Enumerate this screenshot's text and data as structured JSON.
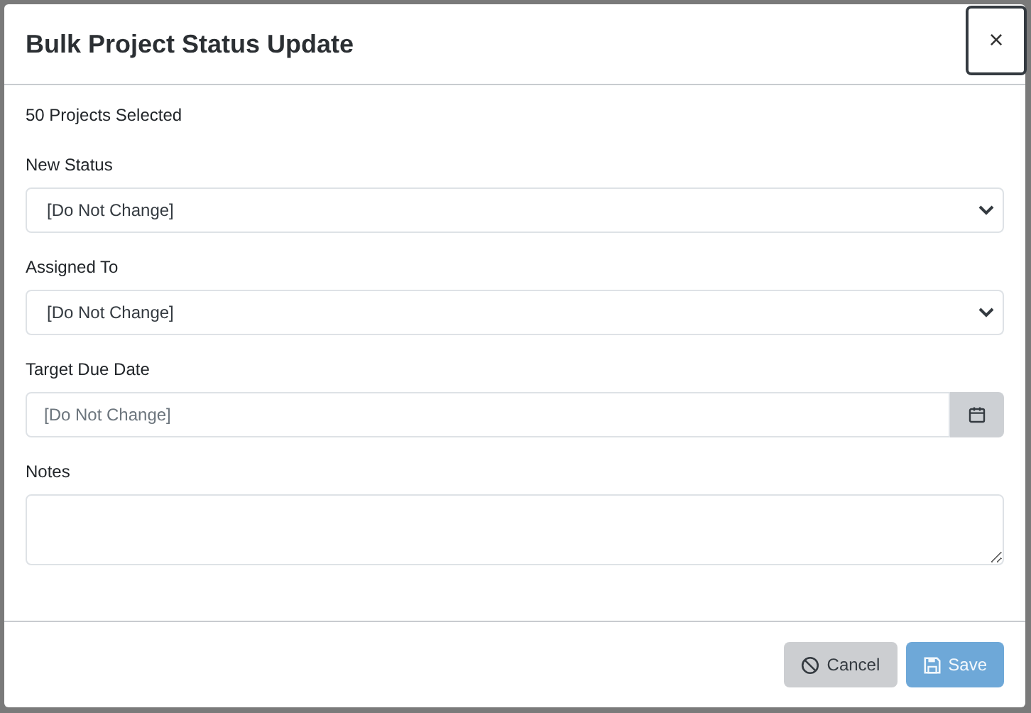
{
  "dialog": {
    "title": "Bulk Project Status Update",
    "close": "×"
  },
  "summary": "50 Projects Selected",
  "fields": [
    {
      "kind": "select",
      "label": "New Status",
      "value": "[Do Not Change]"
    },
    {
      "kind": "select",
      "label": "Assigned To",
      "value": "[Do Not Change]"
    },
    {
      "kind": "date",
      "label": "Target Due Date",
      "placeholder": "[Do Not Change]"
    },
    {
      "kind": "textarea",
      "label": "Notes"
    }
  ],
  "buttons": [
    {
      "kind": "cancel",
      "label": "Cancel",
      "disabled": false
    },
    {
      "kind": "save",
      "label": "Save",
      "disabled": true
    }
  ]
}
